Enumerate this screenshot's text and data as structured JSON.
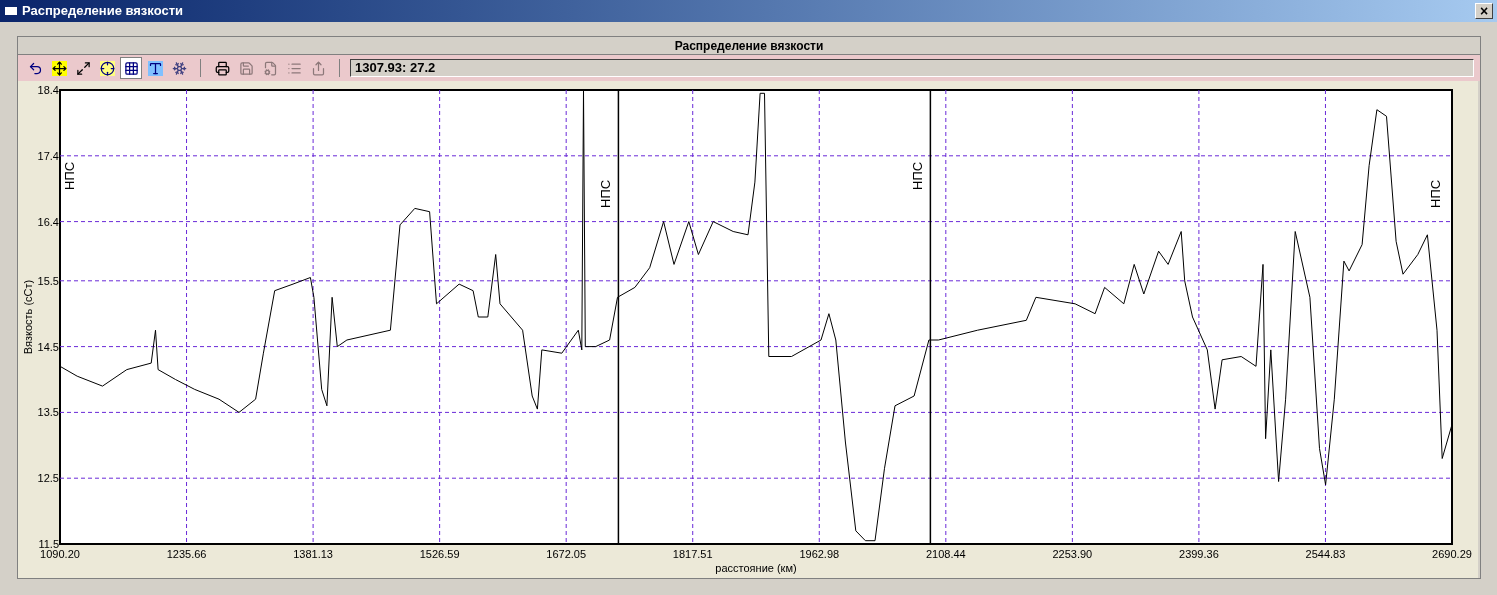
{
  "window": {
    "title": "Распределение вязкости",
    "close": "×"
  },
  "panel": {
    "title": "Распределение вязкости"
  },
  "toolbar": {
    "tools": [
      {
        "pressed": false,
        "disabled": false
      },
      {
        "pressed": false,
        "disabled": false
      },
      {
        "pressed": false,
        "disabled": false
      },
      {
        "pressed": false,
        "disabled": false
      },
      {
        "pressed": true,
        "disabled": false
      },
      {
        "pressed": false,
        "disabled": false
      },
      {
        "pressed": false,
        "disabled": false
      },
      {
        "pressed": false,
        "disabled": false
      },
      {
        "pressed": false,
        "disabled": true
      },
      {
        "pressed": false,
        "disabled": true
      },
      {
        "pressed": false,
        "disabled": true
      },
      {
        "pressed": false,
        "disabled": true
      }
    ],
    "readout": "1307.93: 27.2"
  },
  "chart": {
    "chart_data": {
      "type": "line",
      "xlabel": "расстояние (км)",
      "ylabel": "Вязкость (сСт)",
      "xlim": [
        1090.2,
        2690.29
      ],
      "ylim": [
        11.5,
        18.4
      ],
      "xticks": [
        {
          "value": 1090.2,
          "label": "1090.20"
        },
        {
          "value": 1235.66,
          "label": "1235.66"
        },
        {
          "value": 1381.13,
          "label": "1381.13"
        },
        {
          "value": 1526.59,
          "label": "1526.59"
        },
        {
          "value": 1672.05,
          "label": "1672.05"
        },
        {
          "value": 1817.51,
          "label": "1817.51"
        },
        {
          "value": 1962.98,
          "label": "1962.98"
        },
        {
          "value": 2108.44,
          "label": "2108.44"
        },
        {
          "value": 2253.9,
          "label": "2253.90"
        },
        {
          "value": 2399.36,
          "label": "2399.36"
        },
        {
          "value": 2544.83,
          "label": "2544.83"
        },
        {
          "value": 2690.29,
          "label": "2690.29"
        }
      ],
      "yticks": [
        {
          "value": 11.5,
          "label": "11.5"
        },
        {
          "value": 12.5,
          "label": "12.5"
        },
        {
          "value": 13.5,
          "label": "13.5"
        },
        {
          "value": 14.5,
          "label": "14.5"
        },
        {
          "value": 15.5,
          "label": "15.5"
        },
        {
          "value": 16.4,
          "label": "16.4"
        },
        {
          "value": 17.4,
          "label": "17.4"
        },
        {
          "value": 18.4,
          "label": "18.4"
        }
      ],
      "x": [
        1090.2,
        1110,
        1139,
        1167,
        1195,
        1200,
        1203,
        1223,
        1245,
        1273,
        1296,
        1315,
        1324,
        1337,
        1358,
        1378,
        1382,
        1391,
        1397,
        1403,
        1409,
        1420,
        1470,
        1481,
        1498,
        1515,
        1523,
        1549,
        1565,
        1571,
        1582,
        1591,
        1596,
        1622,
        1633,
        1639,
        1644,
        1667,
        1686,
        1690,
        1692,
        1694,
        1706,
        1722,
        1731,
        1751,
        1768,
        1784,
        1796,
        1813,
        1824,
        1841,
        1864,
        1881,
        1889,
        1895,
        1900,
        1905,
        1931,
        1965,
        1974,
        1982,
        1993,
        2005,
        2016,
        2027,
        2038,
        2050,
        2072,
        2089,
        2100,
        2145,
        2201,
        2212,
        2257,
        2280,
        2291,
        2313,
        2325,
        2336,
        2353,
        2364,
        2379,
        2383,
        2392,
        2409,
        2418,
        2426,
        2448,
        2465,
        2473,
        2476,
        2482,
        2491,
        2499,
        2510,
        2527,
        2538,
        2545,
        2555,
        2566,
        2572,
        2587,
        2595,
        2604,
        2615,
        2626,
        2634,
        2651,
        2662,
        2673,
        2679,
        2690
      ],
      "series": [
        {
          "color": "#000000",
          "values": [
            14.2,
            14.05,
            13.9,
            14.15,
            14.25,
            14.75,
            14.15,
            14.0,
            13.85,
            13.7,
            13.5,
            13.7,
            14.4,
            15.35,
            15.45,
            15.55,
            15.25,
            13.85,
            13.6,
            15.25,
            14.5,
            14.6,
            14.75,
            16.35,
            16.6,
            16.55,
            15.15,
            15.45,
            15.35,
            14.95,
            14.95,
            15.9,
            15.15,
            14.75,
            13.75,
            13.55,
            14.45,
            14.4,
            14.75,
            14.45,
            18.4,
            14.5,
            14.5,
            14.6,
            15.25,
            15.4,
            15.7,
            16.4,
            15.75,
            16.4,
            15.9,
            16.4,
            16.25,
            16.2,
            17.0,
            18.35,
            18.35,
            14.35,
            14.35,
            14.6,
            15.0,
            14.6,
            13.05,
            11.7,
            11.55,
            11.55,
            12.65,
            13.6,
            13.75,
            14.6,
            14.6,
            14.75,
            14.9,
            15.25,
            15.15,
            15.0,
            15.4,
            15.15,
            15.75,
            15.3,
            15.95,
            15.75,
            16.25,
            15.5,
            14.95,
            14.45,
            13.55,
            14.3,
            14.35,
            14.2,
            15.75,
            13.1,
            14.45,
            12.45,
            13.7,
            16.25,
            15.25,
            12.95,
            12.4,
            13.7,
            15.8,
            15.65,
            16.05,
            17.25,
            18.1,
            18.0,
            16.1,
            15.6,
            15.9,
            16.2,
            14.75,
            12.8,
            13.3
          ]
        }
      ],
      "grid": true,
      "ref_lines": [
        {
          "axis": "x",
          "value": 1732.1
        },
        {
          "axis": "x",
          "value": 2090.7
        }
      ],
      "annotations": [
        "НПС",
        "НПС",
        "НПС",
        "НПС"
      ]
    }
  }
}
